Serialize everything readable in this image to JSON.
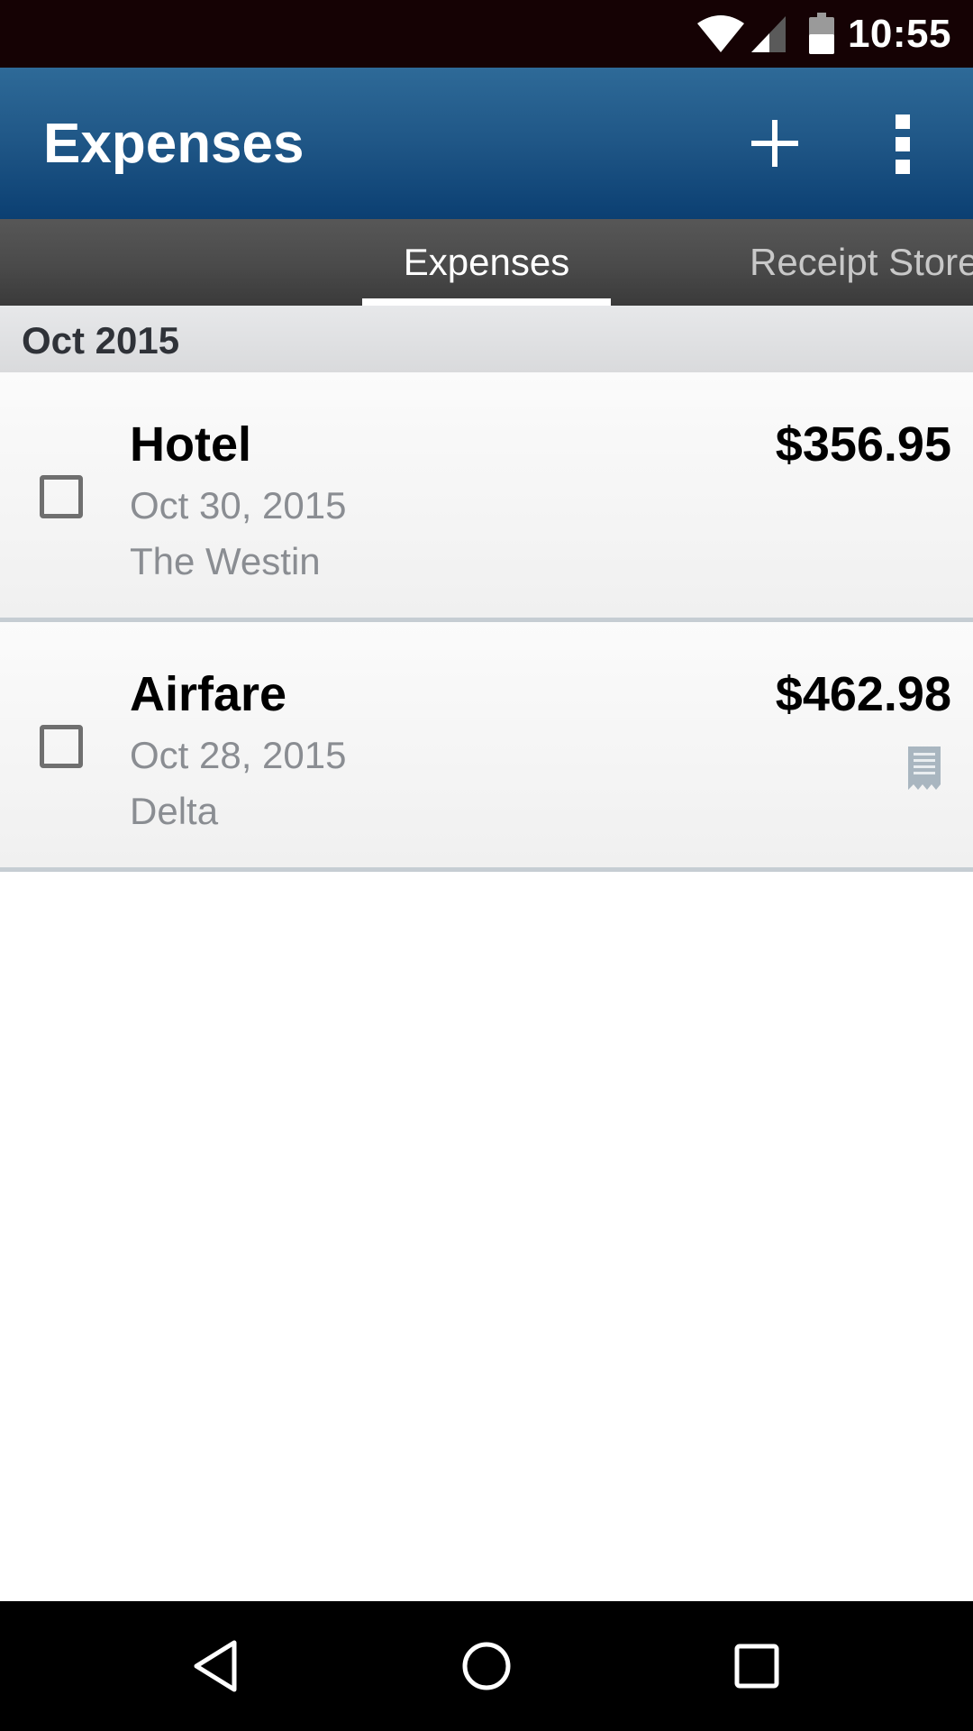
{
  "status_bar": {
    "time": "10:55",
    "icons": [
      "wifi-icon",
      "cell-signal-icon",
      "battery-icon"
    ]
  },
  "app_bar": {
    "title": "Expenses",
    "actions": [
      "add-icon",
      "overflow-menu-icon"
    ]
  },
  "tabs": [
    {
      "label": "Expenses",
      "active": true
    },
    {
      "label": "Receipt Store",
      "active": false
    }
  ],
  "section": {
    "header": "Oct 2015"
  },
  "expenses": [
    {
      "category": "Hotel",
      "date": "Oct 30, 2015",
      "vendor": "The Westin",
      "amount": "$356.95",
      "checked": false,
      "has_receipt": false
    },
    {
      "category": "Airfare",
      "date": "Oct 28, 2015",
      "vendor": "Delta",
      "amount": "$462.98",
      "checked": false,
      "has_receipt": true
    }
  ],
  "nav_bar": {
    "buttons": [
      "back-icon",
      "home-icon",
      "recents-icon"
    ]
  },
  "colors": {
    "status_bar": "#150204",
    "app_bar_top": "#2e6a98",
    "app_bar_bottom": "#0b3f72",
    "tab_bar": "#4a4a4a",
    "section_header": "#e0e1e3",
    "secondary_text": "#8a8d92",
    "receipt_icon": "#a9b6c0"
  }
}
